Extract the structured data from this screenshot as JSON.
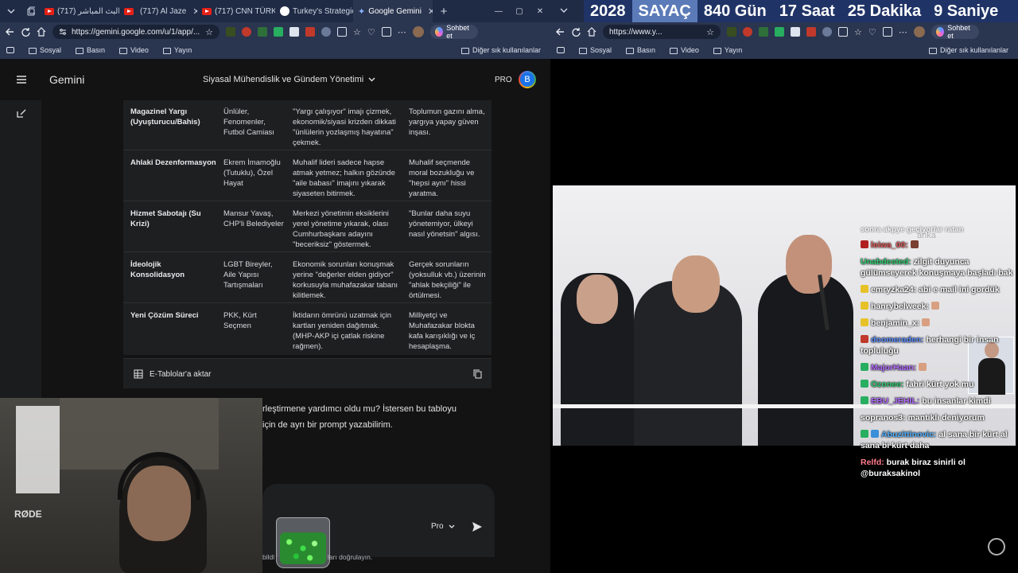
{
  "left_browser": {
    "tabs": [
      {
        "label": "(717) البث المباشر",
        "icon": "youtube-icon"
      },
      {
        "label": "(717) Al Jaze",
        "icon": "youtube-icon"
      },
      {
        "label": "(717) CNN TÜRK",
        "icon": "youtube-icon"
      },
      {
        "label": "Turkey's Strategic",
        "icon": "globe-icon"
      },
      {
        "label": "Google Gemini",
        "icon": "gemini-icon"
      }
    ],
    "url": "https://gemini.google.com/u/1/app/...",
    "copilot_label": "Sohbet et",
    "bookmarks": [
      "Sosyal",
      "Basın",
      "Video",
      "Yayın"
    ],
    "other_bookmarks": "Diğer sık kullanılanlar"
  },
  "gemini": {
    "brand": "Gemini",
    "conversation_title": "Siyasal Mühendislik ve Gündem Yönetimi",
    "plan_badge": "PRO",
    "avatar_letter": "B",
    "table_rows": [
      {
        "c1": "Magazinel Yargı (Uyuşturucu/Bahis)",
        "c2": "Ünlüler, Fenomenler, Futbol Camiası",
        "c3": "\"Yargı çalışıyor\" imajı çizmek, ekonomik/siyasi krizden dikkati \"ünlülerin yozlaşmış hayatına\" çekmek.",
        "c4": "Toplumun gazını alma, yargıya yapay güven inşası."
      },
      {
        "c1": "Ahlaki Dezenformasyon",
        "c2": "Ekrem İmamoğlu (Tutuklu), Özel Hayat",
        "c3": "Muhalif lideri sadece hapse atmak yetmez; halkın gözünde \"aile babası\" imajını yıkarak siyaseten bitirmek.",
        "c4": "Muhalif seçmende moral bozukluğu ve \"hepsi aynı\" hissi yaratma."
      },
      {
        "c1": "Hizmet Sabotajı (Su Krizi)",
        "c2": "Mansur Yavaş, CHP'li Belediyeler",
        "c3": "Merkezi yönetimin eksiklerini yerel yönetime yıkarak, olası Cumhurbaşkanı adayını \"beceriksiz\" göstermek.",
        "c4": "\"Bunlar daha suyu yönetemiyor, ülkeyi nasıl yönetsin\" algısı."
      },
      {
        "c1": "İdeolojik Konsolidasyon",
        "c2": "LGBT Bireyler, Aile Yapısı Tartışmaları",
        "c3": "Ekonomik sorunları konuşmak yerine \"değerler elden gidiyor\" korkusuyla muhafazakar tabanı kilitlemek.",
        "c4": "Gerçek sorunların (yoksulluk vb.) üzerinin \"ahlak bekçiliği\" ile örtülmesi."
      },
      {
        "c1": "Yeni Çözüm Süreci",
        "c2": "PKK, Kürt Seçmen",
        "c3": "İktidarın ömrünü uzatmak için kartları yeniden dağıtmak. (MHP-AKP içi çatlak riskine rağmen).",
        "c4": "Milliyetçi ve Muhafazakar blokta kafa karışıklığı ve iç hesaplaşma."
      }
    ],
    "export_label": "E-Tablolar'a aktar",
    "response_line1": "rleştirmene yardımcı oldu mu? İstersen bu tabloyu",
    "response_line2": "için de ayrı bir prompt yazabilirim.",
    "model_selector": "Pro",
    "disclaimer_left": "bildi",
    "disclaimer_right": "ları doğrulayın."
  },
  "webcam": {
    "mic_brand": "RØDE"
  },
  "right_browser": {
    "url": "https://www.y...",
    "copilot_label": "Sohbet et",
    "bookmarks": [
      "Sosyal",
      "Basın",
      "Video",
      "Yayın"
    ],
    "other_bookmarks": "Diğer sık kullanılanlar"
  },
  "counter": {
    "year": "2028",
    "label": "SAYAÇ",
    "days": "840 Gün",
    "hours": "17 Saat",
    "minutes": "25 Dakika",
    "seconds": "9 Saniye"
  },
  "video": {
    "watermark": "anka"
  },
  "chat": {
    "top_partial": "sonra akpye geçiyorlar ratan",
    "messages": [
      {
        "user": "leiwa_00:",
        "text": "",
        "user_color": "#e05a5a",
        "badge_color": "#b02020"
      },
      {
        "user": "Unabdested:",
        "text": "zilgit duyunca gülümseyerek konuşmaya başladı bak",
        "user_color": "#2ecc71",
        "badge_color": ""
      },
      {
        "user": "emryzka24:",
        "text": "abi e mail ini gordük",
        "user_color": "#ffffff",
        "badge_color": "#e6c228"
      },
      {
        "user": "hanrybelweek:",
        "text": "",
        "user_color": "#ffffff",
        "badge_color": "#e6c228"
      },
      {
        "user": "benjamin_x:",
        "text": "",
        "user_color": "#ffffff",
        "badge_color": "#e6c228"
      },
      {
        "user": "doomeraden:",
        "text": "herhangi bir insan topluluğu",
        "user_color": "#5b8cff",
        "badge_color": "#c0392b"
      },
      {
        "user": "MajorHaan:",
        "text": "",
        "user_color": "#b36bff",
        "badge_color": "#27ae60"
      },
      {
        "user": "Ozonee:",
        "text": "fahri kürt yok mu",
        "user_color": "#2ecc71",
        "badge_color": "#27ae60"
      },
      {
        "user": "EBU_JEHIL:",
        "text": "bu insanlar kimdi",
        "user_color": "#b36bff",
        "badge_color": "#27ae60"
      },
      {
        "user": "sopranos3:",
        "text": "mantıklı deniyorum",
        "user_color": "#ffffff",
        "badge_color": ""
      },
      {
        "user": "Abuzittinovic:",
        "text": "al sana bir kürt al sana bi kürt daha",
        "user_color": "#4fb0ff",
        "badge_color": "#27ae60"
      },
      {
        "user": "Relfd:",
        "text": "burak biraz sinirli ol @buraksakinol",
        "user_color": "#ff7c8a",
        "badge_color": ""
      }
    ]
  }
}
